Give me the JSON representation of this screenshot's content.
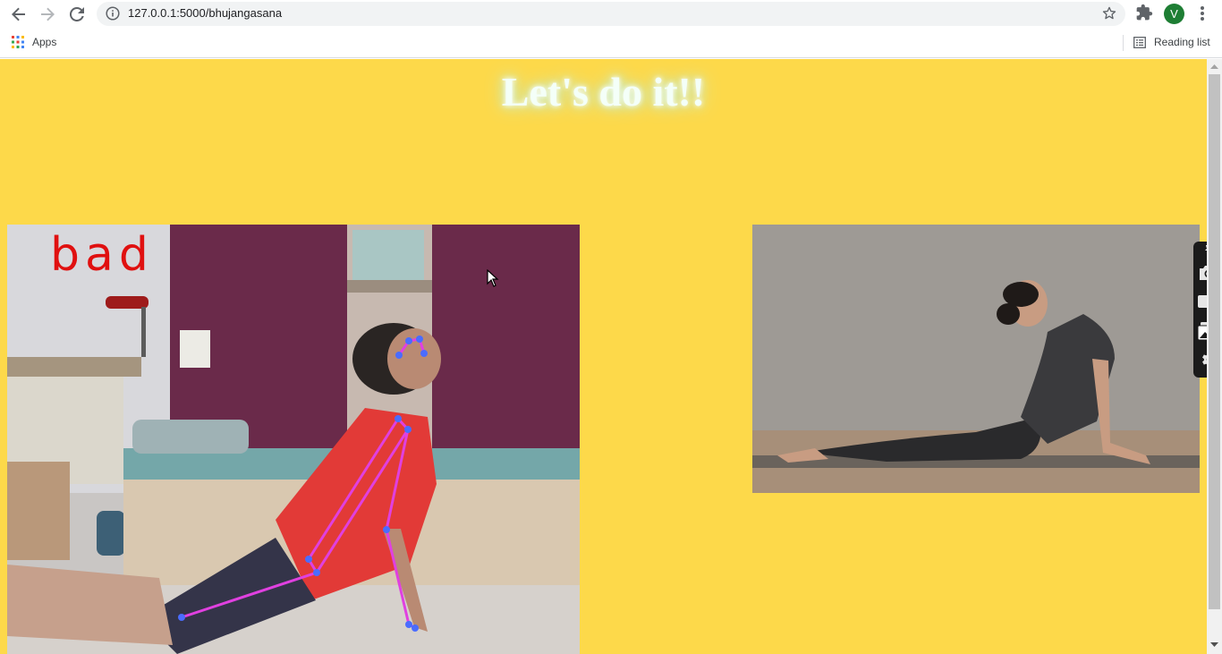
{
  "browser": {
    "url": "127.0.0.1:5000/bhujangasana",
    "profile_initial": "V",
    "bookmarks": {
      "apps_label": "Apps",
      "reading_list_label": "Reading list"
    }
  },
  "page": {
    "heading": "Let's do it!!",
    "background_color": "#fdd94a",
    "webcam_feed": {
      "pose_feedback": "bad",
      "feedback_color": "#e01010",
      "skeleton_color": "#e040e0",
      "keypoint_color": "#4a6cff"
    },
    "reference_image": {
      "pose": "bhujangasana"
    }
  },
  "side_widget": {
    "icons": [
      "pin-icon",
      "camera-icon",
      "video-icon",
      "gallery-icon",
      "settings-icon"
    ]
  }
}
